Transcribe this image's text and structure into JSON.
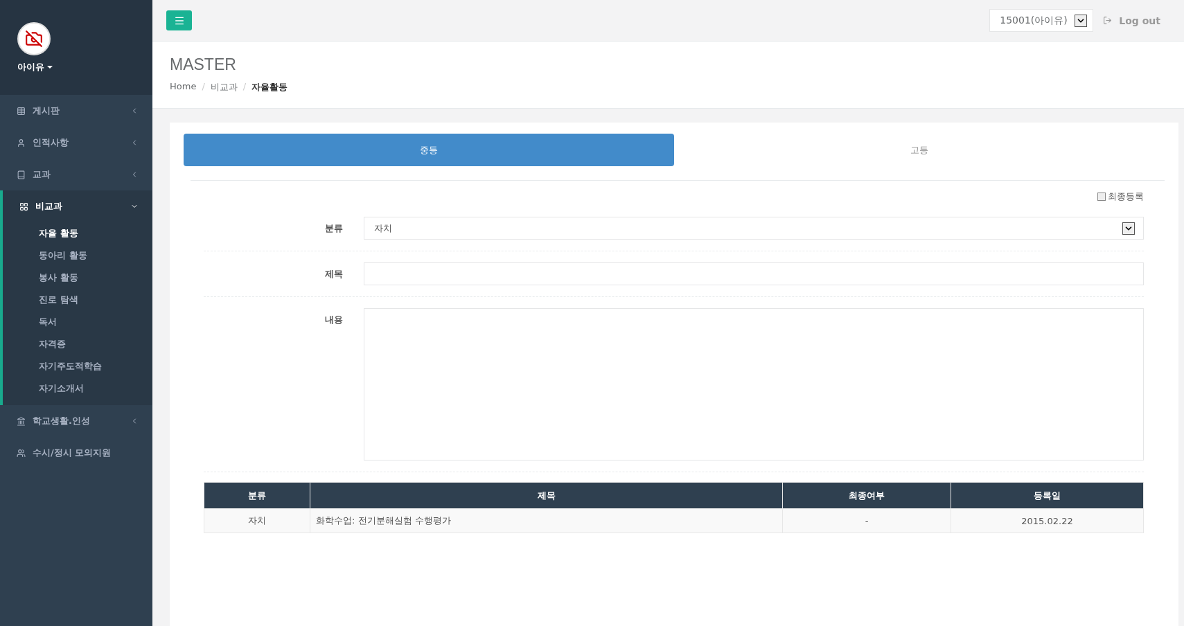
{
  "profile": {
    "name": "아이유"
  },
  "sidebar": {
    "items": [
      {
        "label": "게시판",
        "has_submenu": true,
        "expanded": false,
        "selected": false
      },
      {
        "label": "인적사항",
        "has_submenu": true,
        "expanded": false,
        "selected": false
      },
      {
        "label": "교과",
        "has_submenu": true,
        "expanded": false,
        "selected": false
      },
      {
        "label": "비교과",
        "has_submenu": true,
        "expanded": true,
        "selected": true,
        "children": [
          {
            "label": "자율 활동",
            "selected": true
          },
          {
            "label": "동아리 활동",
            "selected": false
          },
          {
            "label": "봉사 활동",
            "selected": false
          },
          {
            "label": "진로 탐색",
            "selected": false
          },
          {
            "label": "독서",
            "selected": false
          },
          {
            "label": "자격증",
            "selected": false
          },
          {
            "label": "자기주도적학습",
            "selected": false
          },
          {
            "label": "자기소개서",
            "selected": false
          }
        ]
      },
      {
        "label": "학교생활.인성",
        "has_submenu": true,
        "expanded": false,
        "selected": false
      },
      {
        "label": "수시/정시 모의지원",
        "has_submenu": false,
        "selected": false
      }
    ]
  },
  "topbar": {
    "user_select": {
      "value": "15001(아이유)"
    },
    "logout": "Log out"
  },
  "page": {
    "title": "MASTER",
    "breadcrumb": [
      "Home",
      "비교과",
      "자율활동"
    ],
    "breadcrumb_separators": [
      "/",
      "/"
    ]
  },
  "tabs": [
    {
      "label": "중등",
      "selected": true
    },
    {
      "label": "고등",
      "selected": false
    }
  ],
  "final_register": {
    "label": "최종등록",
    "checked": false
  },
  "form": [
    {
      "label": "분류",
      "kind": "select",
      "value": "자치"
    },
    {
      "label": "제목",
      "kind": "text"
    },
    {
      "label": "내용",
      "kind": "textarea"
    }
  ],
  "table": {
    "columns": [
      "분류",
      "제목",
      "최종여부",
      "등록일"
    ],
    "rows": [
      [
        "자치",
        "화학수업: 전기분해실험 수행평가",
        "-",
        "2015.02.22"
      ]
    ]
  }
}
